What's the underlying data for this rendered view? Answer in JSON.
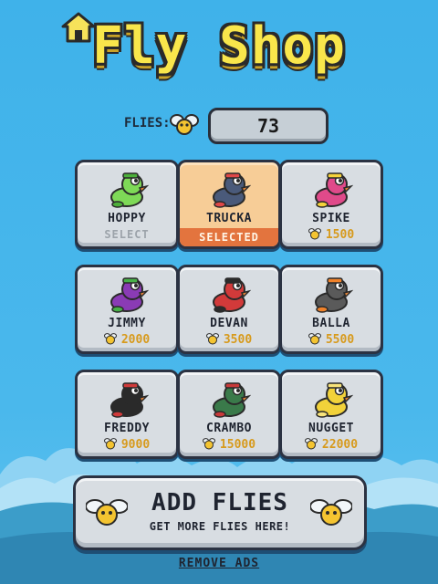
{
  "header": {
    "title": "Fly Shop"
  },
  "flies": {
    "label": "FLIES:",
    "count": "73"
  },
  "characters": [
    {
      "name": "HOPPY",
      "status": "SELECT",
      "price": "",
      "body": "#7ed957",
      "accent": "#4caf3a"
    },
    {
      "name": "TRUCKA",
      "status": "SELECTED",
      "price": "",
      "body": "#4a5a7a",
      "accent": "#e04848"
    },
    {
      "name": "SPIKE",
      "status": "",
      "price": "1500",
      "body": "#e04a8a",
      "accent": "#f5d23a"
    },
    {
      "name": "JIMMY",
      "status": "",
      "price": "2000",
      "body": "#8a3bb5",
      "accent": "#48b048"
    },
    {
      "name": "DEVAN",
      "status": "",
      "price": "3500",
      "body": "#d23a3a",
      "accent": "#2a2a2a"
    },
    {
      "name": "BALLA",
      "status": "",
      "price": "5500",
      "body": "#5a5a5a",
      "accent": "#f0822a"
    },
    {
      "name": "FREDDY",
      "status": "",
      "price": "9000",
      "body": "#2a2a2a",
      "accent": "#d03a3a"
    },
    {
      "name": "CRAMBO",
      "status": "",
      "price": "15000",
      "body": "#3a7a4a",
      "accent": "#c83a3a"
    },
    {
      "name": "NUGGET",
      "status": "",
      "price": "22000",
      "body": "#f2d23a",
      "accent": "#f7e37a"
    }
  ],
  "add_button": {
    "title": "ADD FLIES",
    "subtitle": "GET MORE FLIES HERE!"
  },
  "remove_ads": "REMOVE ADS",
  "colors": {
    "sky": "#45b5ea",
    "title_yellow": "#f9e64b",
    "selected_bg": "#f7cd97",
    "selected_bar": "#e3743e",
    "price_gold": "#d79a1c"
  }
}
